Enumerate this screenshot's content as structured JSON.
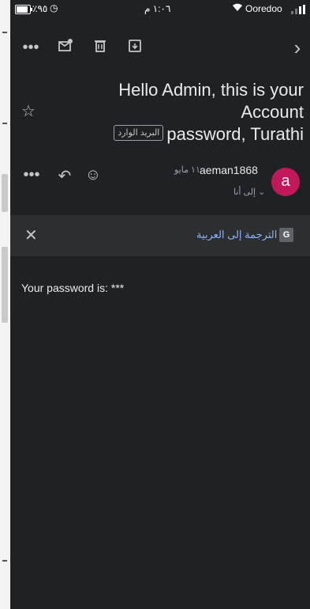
{
  "status_bar": {
    "battery": "٪٩٥",
    "time": "١:٠٦ م",
    "carrier": "Ooredoo"
  },
  "icons": {
    "more": "more-horiz-icon",
    "mark_unread": "mark-unread-icon",
    "delete": "trash-icon",
    "archive": "archive-icon",
    "next": "chevron-right-icon",
    "star": "star-outline-icon",
    "reply": "reply-icon",
    "emoji": "emoji-icon",
    "close": "close-icon",
    "translate": "google-translate-icon"
  },
  "email": {
    "subject_line1": "Hello Admin, this is your Account",
    "subject_line2": "password, Turathi",
    "label": "البريد الوارد",
    "sender_name": "aeman1868",
    "date": "١١ مايو",
    "recipient": "إلى أنا ⌄",
    "avatar_letter": "a",
    "body": "Your password is: ***"
  },
  "translate_bar": {
    "link": "الترجمة إلى العربية"
  },
  "colors": {
    "background": "#202124",
    "translate_bar": "#2d2e30",
    "avatar": "#c2185b",
    "link": "#8ab4f8"
  }
}
